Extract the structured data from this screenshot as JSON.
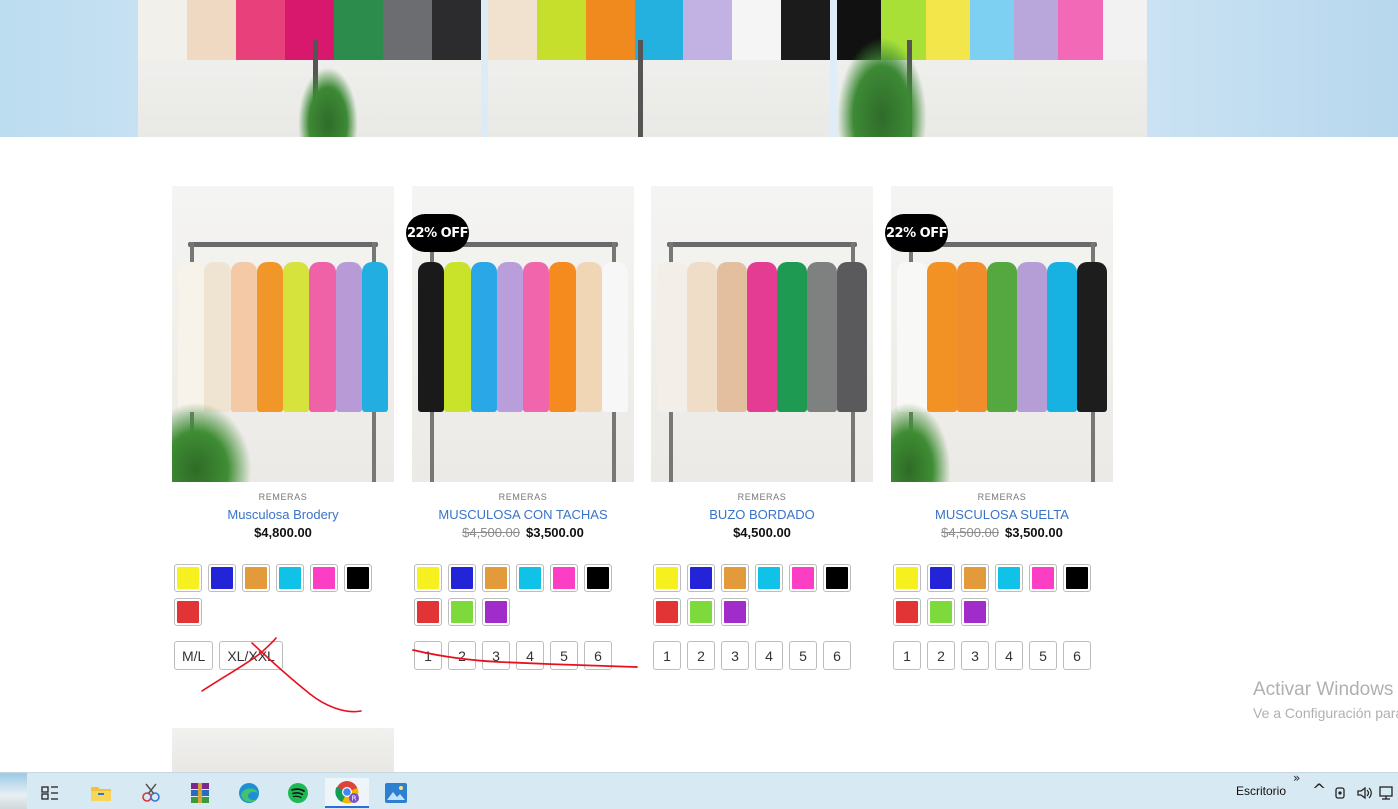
{
  "products": [
    {
      "category": "REMERAS",
      "name": "Musculosa Brodery",
      "old_price": "",
      "price": "$4,800.00",
      "badge": "",
      "garment_colors": [
        "#f7f2ea",
        "#efe3d2",
        "#f3c9a6",
        "#f1972a",
        "#d7e33d",
        "#f062a8",
        "#b89ad6",
        "#22aee0"
      ],
      "swatches": [
        "#f5f01e",
        "#2323d8",
        "#e29a3a",
        "#10c2e8",
        "#fc3ec5",
        "#000000",
        "#e23434"
      ],
      "sizes": [
        "M/L",
        "XL/XXL"
      ]
    },
    {
      "category": "REMERAS",
      "name": "MUSCULOSA CON TACHAS",
      "old_price": "$4,500.00",
      "price": "$3,500.00",
      "badge": "22% OFF",
      "garment_colors": [
        "#1a1a1a",
        "#c9e22a",
        "#2aa7e6",
        "#b99edb",
        "#f065ac",
        "#f58a1f",
        "#f1d6b6",
        "#f7f7f7"
      ],
      "swatches": [
        "#f5f01e",
        "#2323d8",
        "#e29a3a",
        "#10c2e8",
        "#fc3ec5",
        "#000000",
        "#e23434",
        "#7ed93c",
        "#a02cc9"
      ],
      "sizes": [
        "1",
        "2",
        "3",
        "4",
        "5",
        "6"
      ]
    },
    {
      "category": "REMERAS",
      "name": "BUZO BORDADO",
      "old_price": "",
      "price": "$4,500.00",
      "badge": "",
      "garment_colors": [
        "#f3efe8",
        "#f0ddc7",
        "#e3bfa0",
        "#e43b93",
        "#1f9a52",
        "#7f8080",
        "#5a5a5c"
      ],
      "swatches": [
        "#f5f01e",
        "#2323d8",
        "#e29a3a",
        "#10c2e8",
        "#fc3ec5",
        "#000000",
        "#e23434",
        "#7ed93c",
        "#a02cc9"
      ],
      "sizes": [
        "1",
        "2",
        "3",
        "4",
        "5",
        "6"
      ]
    },
    {
      "category": "REMERAS",
      "name": "MUSCULOSA SUELTA",
      "old_price": "$4,500.00",
      "price": "$3,500.00",
      "badge": "22% OFF",
      "garment_colors": [
        "#f8f8f6",
        "#f29225",
        "#ef8e2a",
        "#55a83f",
        "#b59ed6",
        "#17b2e2",
        "#1d1d1d"
      ],
      "swatches": [
        "#f5f01e",
        "#2323d8",
        "#e29a3a",
        "#10c2e8",
        "#fc3ec5",
        "#000000",
        "#e23434",
        "#7ed93c",
        "#a02cc9"
      ],
      "sizes": [
        "1",
        "2",
        "3",
        "4",
        "5",
        "6"
      ]
    }
  ],
  "watermark": {
    "line1": "Activar Windows",
    "line2": "Ve a Configuración para activar Windows."
  },
  "taskbar": {
    "icons": [
      "task-view-icon",
      "file-explorer-icon",
      "snipping-tool-icon",
      "winrar-icon",
      "edge-icon",
      "spotify-icon",
      "chrome-icon",
      "photos-icon"
    ],
    "desktop_label": "Escritorio",
    "overflow_glyph": "»",
    "chevron_glyph": "^"
  },
  "hero_colors": [
    "#f2f0ea",
    "#efd9c2",
    "#e8407a",
    "#d8186c",
    "#2c8c4c",
    "#6b6d70",
    "#2c2c2e",
    "#f0e2cf",
    "#c6de2c",
    "#f08a1e",
    "#24b1df",
    "#c2b2e3",
    "#f5f5f5",
    "#1b1b1b",
    "#111",
    "#a8e038",
    "#f2e64a",
    "#7ed0f2",
    "#b9a7dc",
    "#f26ab7",
    "#f2f2f2"
  ]
}
